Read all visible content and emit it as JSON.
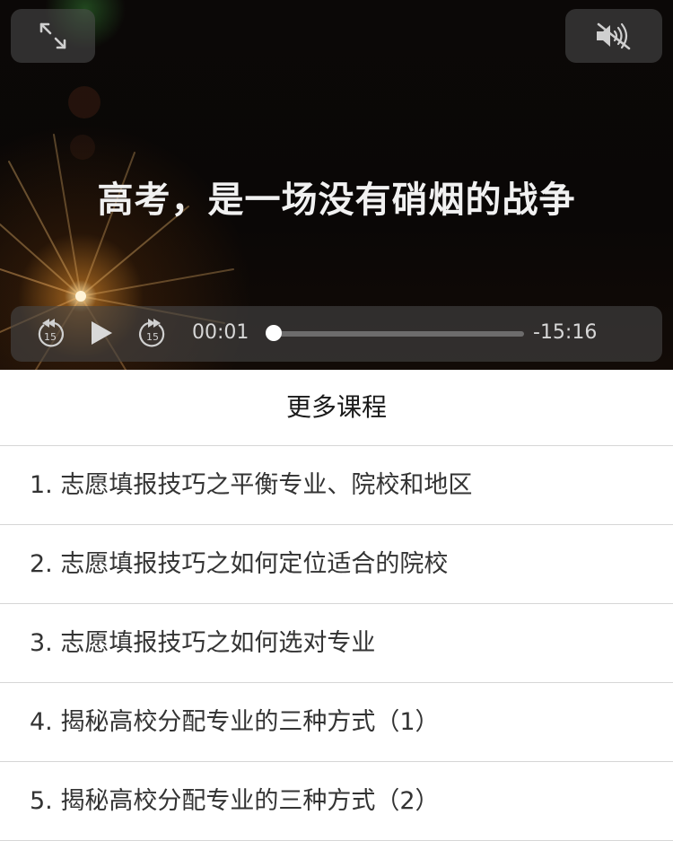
{
  "video": {
    "subtitle": "高考，是一场没有硝烟的战争",
    "current_time": "00:01",
    "remaining_time": "-15:16",
    "progress": 0.01
  },
  "icons": {
    "fullscreen": "expand-arrows-icon",
    "mute": "speaker-muted-icon",
    "rewind": "rewind-15-icon",
    "play": "play-icon",
    "forward": "forward-15-icon"
  },
  "skip_label": "15",
  "list": {
    "title": "更多课程",
    "items": [
      "1. 志愿填报技巧之平衡专业、院校和地区",
      "2. 志愿填报技巧之如何定位适合的院校",
      "3. 志愿填报技巧之如何选对专业",
      "4. 揭秘高校分配专业的三种方式（1）",
      "5. 揭秘高校分配专业的三种方式（2）"
    ]
  }
}
